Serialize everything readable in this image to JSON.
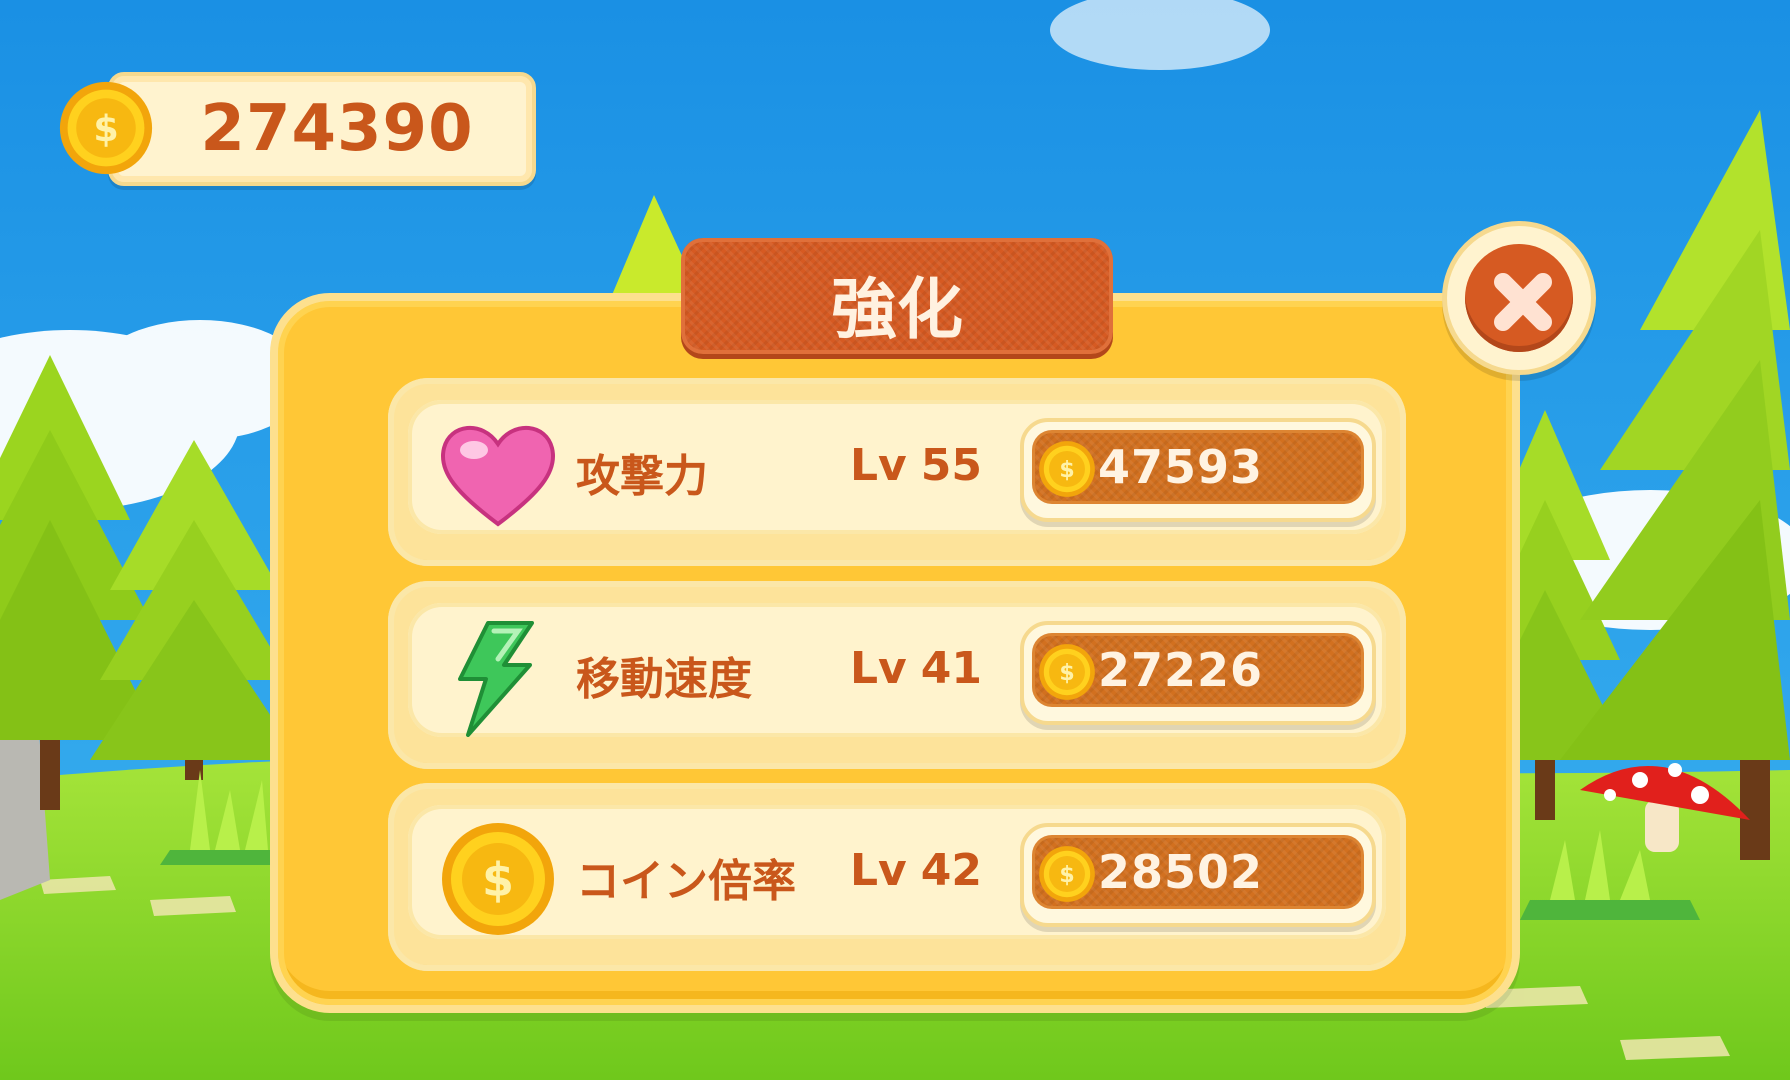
{
  "hud": {
    "coins": "274390"
  },
  "modal": {
    "title": "強化",
    "close_icon": "close-icon"
  },
  "upgrades": [
    {
      "icon": "heart-icon",
      "name": "攻撃力",
      "level_prefix": "Lv",
      "level": "55",
      "cost": "47593"
    },
    {
      "icon": "lightning-icon",
      "name": "移動速度",
      "level_prefix": "Lv",
      "level": "41",
      "cost": "27226"
    },
    {
      "icon": "coin-icon",
      "name": "コイン倍率",
      "level_prefix": "Lv",
      "level": "42",
      "cost": "28502"
    }
  ],
  "colors": {
    "sky": "#1e9be6",
    "panel": "#ffc736",
    "title_bar": "#d65a22",
    "text_orange": "#c9571b",
    "button_orange": "#d2701f",
    "grass": "#8ed82a"
  }
}
